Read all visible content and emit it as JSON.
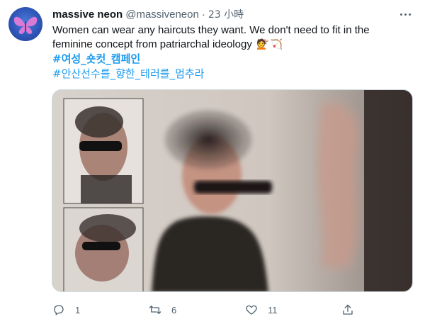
{
  "tweet": {
    "display_name": "massive neon",
    "handle": "@massiveneon",
    "separator": "·",
    "time": "23 小時",
    "text_line": "Women can wear any haircuts they want. We don't need to fit in the feminine concept from patriarchal ideology",
    "emoji_icons": [
      "haircut-emoji",
      "bow-and-arrow-emoji"
    ],
    "hashtags": [
      "#여성_숏컷_캠페인",
      "#안산선수를_향한_테러를_멈추라"
    ],
    "media": {
      "description_icon": "photo-collage"
    },
    "actions": {
      "reply_count": "1",
      "retweet_count": "6",
      "like_count": "11",
      "share_label": ""
    }
  },
  "colors": {
    "text": "#0f1419",
    "secondary": "#536471",
    "link": "#1d9bf0",
    "border": "#cfd9de",
    "avatar_bg": "#2f56b8",
    "avatar_butterfly": "#e27bd6"
  }
}
